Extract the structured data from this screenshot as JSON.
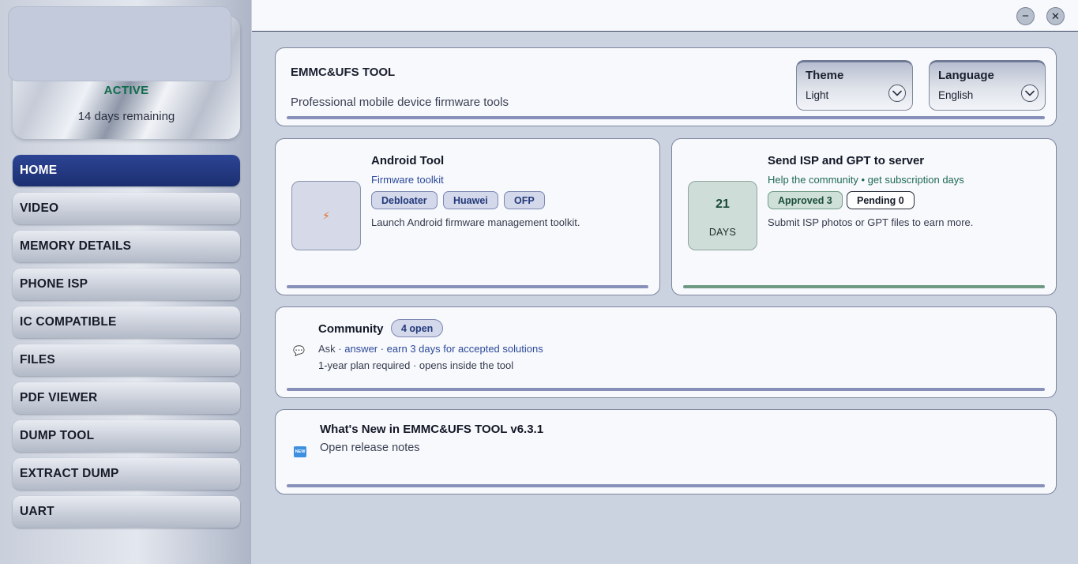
{
  "license": {
    "status": "ACTIVE",
    "days_remaining": "14 days remaining"
  },
  "sidebar": {
    "items": [
      {
        "label": "HOME",
        "active": true
      },
      {
        "label": "VIDEO"
      },
      {
        "label": "MEMORY DETAILS"
      },
      {
        "label": "PHONE ISP"
      },
      {
        "label": "IC COMPATIBLE"
      },
      {
        "label": "FILES"
      },
      {
        "label": "PDF VIEWER"
      },
      {
        "label": "DUMP TOOL"
      },
      {
        "label": "EXTRACT DUMP"
      },
      {
        "label": "UART"
      }
    ]
  },
  "window": {
    "minimize_symbol": "−",
    "close_symbol": "✕"
  },
  "header": {
    "title": "EMMC&UFS TOOL",
    "subtitle": "Professional mobile device firmware tools",
    "theme": {
      "label": "Theme",
      "value": "Light"
    },
    "language": {
      "label": "Language",
      "value": "English"
    }
  },
  "android_tool": {
    "title": "Android Tool",
    "subtitle": "Firmware toolkit",
    "chips": [
      "Debloater",
      "Huawei",
      "OFP"
    ],
    "description": "Launch Android firmware management toolkit.",
    "icon": "⚡"
  },
  "isp": {
    "title": "Send ISP and GPT to server",
    "subtitle": "Help the community • get subscription days",
    "days_value": "21",
    "days_label": "DAYS",
    "approved": "Approved 3",
    "pending": "Pending 0",
    "description": "Submit ISP photos or GPT files to earn more."
  },
  "community": {
    "title": "Community",
    "badge": "4 open",
    "line1_ask": "Ask",
    "line1_rest": " · answer · earn 3 days for accepted solutions",
    "line2": "1-year plan required · opens inside the tool",
    "icon": "💬"
  },
  "news": {
    "title": "What's New in EMMC&UFS TOOL v6.3.1",
    "link": "Open release notes",
    "icon_text": "NEW"
  },
  "colors": {
    "accent": "#1c2f70",
    "active_status": "#0f6b4b",
    "link_blue": "#2c4a9a",
    "link_green": "#1f6a52"
  },
  "icons": {
    "chevron": "chevron-down-icon",
    "bolt": "bolt-icon",
    "chat": "chat-bubble-icon",
    "new": "new-badge-icon"
  }
}
